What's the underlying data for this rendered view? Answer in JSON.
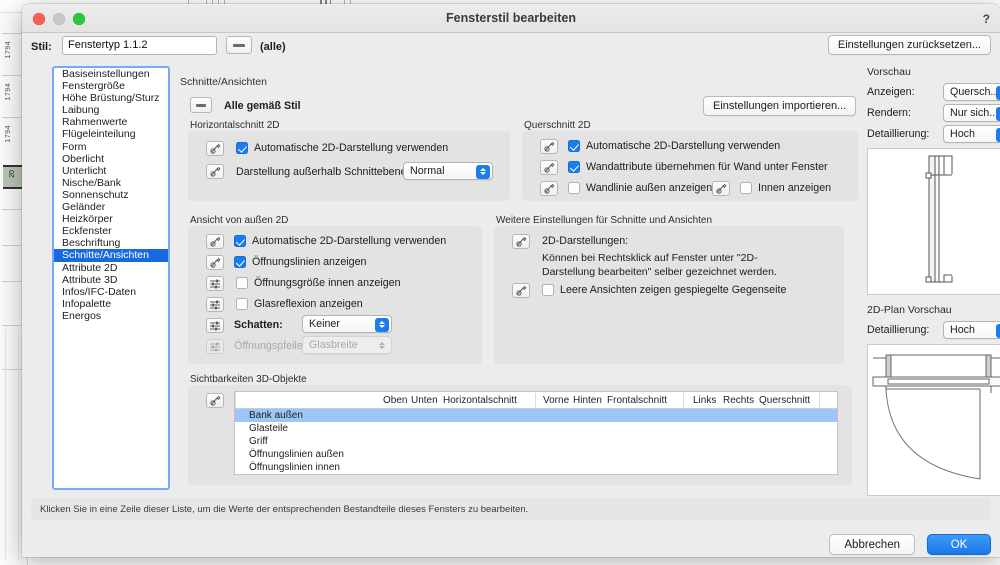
{
  "background": {
    "ruler_marks": [
      "1794",
      "1794",
      "1794"
    ],
    "ruler_highlight": "20"
  },
  "window": {
    "title": "Fensterstil bearbeiten",
    "help_icon": "?",
    "traffic_lights": [
      "close-button",
      "minimize-button",
      "zoom-button"
    ]
  },
  "style_row": {
    "label": "Stil:",
    "value": "Fenstertyp 1.1.2",
    "placeholder": "Fenstertyp",
    "pen_icon": "pen-dash-icon",
    "all_label": "(alle)",
    "reset_button": "Einstellungen zurücksetzen..."
  },
  "sidebar": {
    "items": [
      {
        "label": "Basiseinstellungen",
        "selected": false
      },
      {
        "label": "Fenstergröße",
        "selected": false
      },
      {
        "label": "Höhe Brüstung/Sturz",
        "selected": false
      },
      {
        "label": "Laibung",
        "selected": false
      },
      {
        "label": "Rahmenwerte",
        "selected": false
      },
      {
        "label": "Flügeleinteilung",
        "selected": false
      },
      {
        "label": "Form",
        "selected": false
      },
      {
        "label": "Oberlicht",
        "selected": false
      },
      {
        "label": "Unterlicht",
        "selected": false
      },
      {
        "label": "Nische/Bank",
        "selected": false
      },
      {
        "label": "Sonnenschutz",
        "selected": false
      },
      {
        "label": "Geländer",
        "selected": false
      },
      {
        "label": "Heizkörper",
        "selected": false
      },
      {
        "label": "Eckfenster",
        "selected": false
      },
      {
        "label": "Beschriftung",
        "selected": false
      },
      {
        "label": "Schnitte/Ansichten",
        "selected": true
      },
      {
        "label": "Attribute 2D",
        "selected": false
      },
      {
        "label": "Attribute 3D",
        "selected": false
      },
      {
        "label": "Infos/IFC-Daten",
        "selected": false
      },
      {
        "label": "Infopalette",
        "selected": false
      },
      {
        "label": "Energos",
        "selected": false
      }
    ]
  },
  "main": {
    "section_title": "Schnitte/Ansichten",
    "all_per_style": {
      "label": "Alle gemäß Stil",
      "icon": "pen-dash-icon"
    },
    "import_button": "Einstellungen importieren...",
    "groups": {
      "horizontal_2d": {
        "title": "Horizontalschnitt 2D",
        "auto_2d": {
          "label": "Automatische 2D-Darstellung verwenden",
          "checked": true
        },
        "outside_plane": {
          "label": "Darstellung außerhalb Schnittebene:",
          "value": "Normal"
        }
      },
      "cross_2d": {
        "title": "Querschnitt 2D",
        "auto_2d": {
          "label": "Automatische 2D-Darstellung verwenden",
          "checked": true
        },
        "wall_attrs": {
          "label": "Wandattribute übernehmen für Wand unter Fenster",
          "checked": true
        },
        "wall_line_outside": {
          "label": "Wandlinie außen anzeigen",
          "checked": false
        },
        "show_inside": {
          "label": "Innen anzeigen",
          "checked": false
        }
      },
      "exterior_view_2d": {
        "title": "Ansicht von außen 2D",
        "rows": [
          {
            "label": "Automatische 2D-Darstellung verwenden",
            "checked": true,
            "icon": "pen-icon",
            "disabled": false
          },
          {
            "label": "Öffnungslinien anzeigen",
            "checked": true,
            "icon": "pen-icon",
            "disabled": false
          },
          {
            "label": "Öffnungsgröße innen anzeigen",
            "checked": false,
            "icon": "sliders-icon",
            "disabled": false
          },
          {
            "label": "Glasreflexion anzeigen",
            "checked": false,
            "icon": "sliders-icon",
            "disabled": false
          }
        ],
        "shadow": {
          "label": "Schatten:",
          "value": "Keiner",
          "icon": "sliders-icon",
          "disabled": false
        },
        "opening_arrows": {
          "label": "Öffnungspfeile:",
          "value": "Glasbreite",
          "icon": "sliders-icon",
          "disabled": true
        }
      },
      "further_settings": {
        "title": "Weitere Einstellungen für Schnitte und Ansichten",
        "representation_label": "2D-Darstellungen:",
        "help_text": "Können bei Rechtsklick auf Fenster unter \"2D-Darstellung bearbeiten\" selber gezeichnet werden.",
        "empty_views": {
          "label": "Leere Ansichten zeigen gespiegelte Gegenseite",
          "checked": false
        }
      }
    },
    "visibility_table": {
      "title": "Sichtbarkeiten 3D-Objekte",
      "columns": [
        "Oben",
        "Unten",
        "Horizontalschnitt",
        "Vorne",
        "Hinten",
        "Frontalschnitt",
        "Links",
        "Rechts",
        "Querschnitt"
      ],
      "rows": [
        {
          "name": "Bank außen",
          "selected": true
        },
        {
          "name": "Glasteile",
          "selected": false
        },
        {
          "name": "Griff",
          "selected": false
        },
        {
          "name": "Öffnungslinien außen",
          "selected": false
        },
        {
          "name": "Öffnungslinien innen",
          "selected": false
        }
      ]
    }
  },
  "preview": {
    "title": "Vorschau",
    "show": {
      "label": "Anzeigen:",
      "value": "Quersch..."
    },
    "render": {
      "label": "Rendern:",
      "value": "Nur sich..."
    },
    "detail": {
      "label": "Detaillierung:",
      "value": "Hoch"
    },
    "plan_title": "2D-Plan Vorschau",
    "plan_detail": {
      "label": "Detaillierung:",
      "value": "Hoch"
    }
  },
  "footer": {
    "status": "Klicken Sie in eine Zeile dieser Liste, um die Werte der entsprechenden Bestandteile dieses Fensters zu bearbeiten.",
    "cancel": "Abbrechen",
    "ok": "OK"
  },
  "colors": {
    "accent": "#1a7ced",
    "selection": "#1869e0",
    "row_selection": "#9cc6f5",
    "panel_bg": "#ececec",
    "group_bg": "#e3e3e3"
  }
}
